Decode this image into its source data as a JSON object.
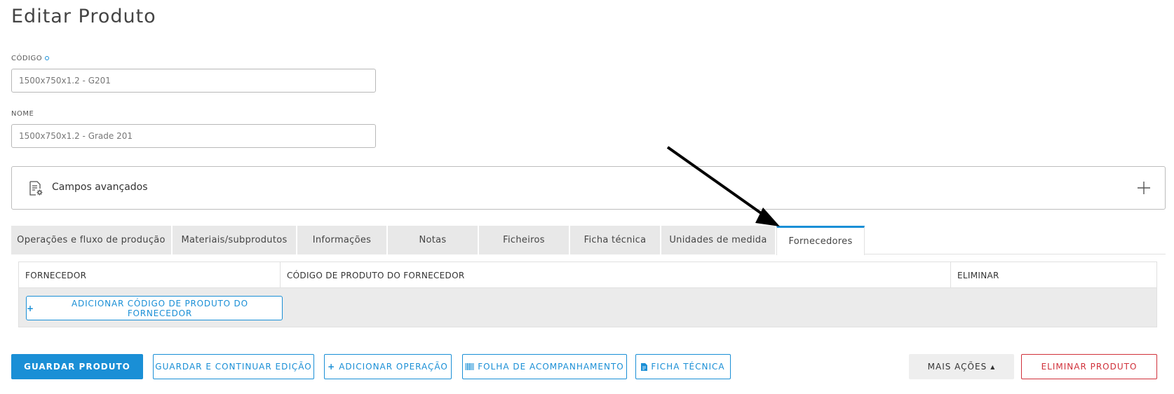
{
  "page": {
    "title": "Editar Produto"
  },
  "form": {
    "code_label": "CÓDIGO",
    "code_value": "1500x750x1.2 - G201",
    "name_label": "NOME",
    "name_value": "1500x750x1.2 - Grade 201"
  },
  "advanced": {
    "label": "Campos avançados",
    "icon": "settings-document-icon",
    "expand_icon": "plus-icon"
  },
  "tabs": [
    {
      "label": "Operações e fluxo de produção"
    },
    {
      "label": "Materiais/subprodutos"
    },
    {
      "label": "Informações"
    },
    {
      "label": "Notas"
    },
    {
      "label": "Ficheiros"
    },
    {
      "label": "Ficha técnica"
    },
    {
      "label": "Unidades de medida"
    },
    {
      "label": "Fornecedores",
      "active": true
    }
  ],
  "suppliers_table": {
    "headers": [
      "FORNECEDOR",
      "CÓDIGO DE PRODUTO DO FORNECEDOR",
      "ELIMINAR"
    ],
    "add_button": "ADICIONAR CÓDIGO DE PRODUTO DO FORNECEDOR"
  },
  "actions": {
    "save": "GUARDAR PRODUTO",
    "save_continue": "GUARDAR E CONTINUAR EDIÇÃO",
    "add_operation": "ADICIONAR OPERAÇÃO",
    "tracking_sheet": "FOLHA DE ACOMPANHAMENTO",
    "datasheet": "FICHA TÉCNICA",
    "more_actions": "MAIS AÇÕES",
    "delete": "ELIMINAR PRODUTO"
  },
  "colors": {
    "accent": "#1a8fd6",
    "danger": "#d0303a",
    "tab_bg": "#e8e8e8"
  }
}
